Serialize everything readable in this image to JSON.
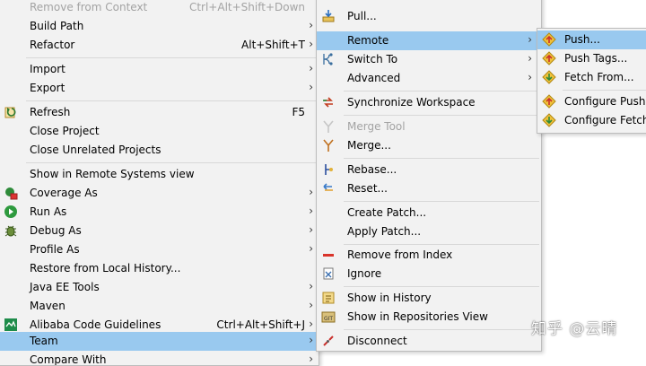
{
  "context_menu": {
    "items": [
      {
        "label": "Remove from Context",
        "accel": "Ctrl+Alt+Shift+Down",
        "disabled": true
      },
      {
        "label": "Build Path"
      },
      {
        "label": "Refactor",
        "accel": "Alt+Shift+T"
      },
      {
        "label": "Import"
      },
      {
        "label": "Export"
      },
      {
        "label": "Refresh",
        "accel": "F5",
        "icon": "refresh-icon"
      },
      {
        "label": "Close Project"
      },
      {
        "label": "Close Unrelated Projects"
      },
      {
        "label": "Show in Remote Systems view"
      },
      {
        "label": "Coverage As",
        "icon": "coverage-icon"
      },
      {
        "label": "Run As",
        "icon": "run-icon"
      },
      {
        "label": "Debug As",
        "icon": "debug-bug-icon"
      },
      {
        "label": "Profile As"
      },
      {
        "label": "Restore from Local History..."
      },
      {
        "label": "Java EE Tools"
      },
      {
        "label": "Maven"
      },
      {
        "label": "Alibaba Code Guidelines",
        "accel": "Ctrl+Alt+Shift+J",
        "icon": "alibaba-guidelines-icon"
      },
      {
        "label": "Team",
        "selected": true
      },
      {
        "label": "Compare With"
      }
    ]
  },
  "team_menu": {
    "items": [
      {
        "label": "Pull...",
        "icon": "pull-icon"
      },
      {
        "label": "Remote",
        "selected": true
      },
      {
        "label": "Switch To",
        "icon": "switch-branch-icon"
      },
      {
        "label": "Advanced"
      },
      {
        "label": "Synchronize Workspace",
        "icon": "synchronize-icon"
      },
      {
        "label": "Merge Tool",
        "disabled": true,
        "icon": "merge-tool-icon"
      },
      {
        "label": "Merge...",
        "icon": "merge-icon"
      },
      {
        "label": "Rebase...",
        "icon": "rebase-icon"
      },
      {
        "label": "Reset...",
        "icon": "reset-icon"
      },
      {
        "label": "Create Patch..."
      },
      {
        "label": "Apply Patch..."
      },
      {
        "label": "Remove from Index",
        "icon": "remove-index-icon"
      },
      {
        "label": "Ignore",
        "icon": "ignore-icon"
      },
      {
        "label": "Show in History",
        "icon": "history-icon"
      },
      {
        "label": "Show in Repositories View",
        "icon": "repositories-icon"
      },
      {
        "label": "Disconnect",
        "icon": "disconnect-icon"
      }
    ]
  },
  "remote_menu": {
    "items": [
      {
        "label": "Push...",
        "icon": "push-icon",
        "selected": true
      },
      {
        "label": "Push Tags...",
        "icon": "push-tags-icon"
      },
      {
        "label": "Fetch From...",
        "icon": "fetch-icon"
      },
      {
        "label": "Configure Push t",
        "icon": "configure-push-icon"
      },
      {
        "label": "Configure Fetch f",
        "icon": "configure-fetch-icon"
      }
    ]
  },
  "watermark": "知乎 @云晴",
  "colors": {
    "menu_bg": "#f2f2f2",
    "selection": "#99c9ef",
    "disabled_text": "#a3a3a3",
    "separator": "#d8d8d8"
  }
}
